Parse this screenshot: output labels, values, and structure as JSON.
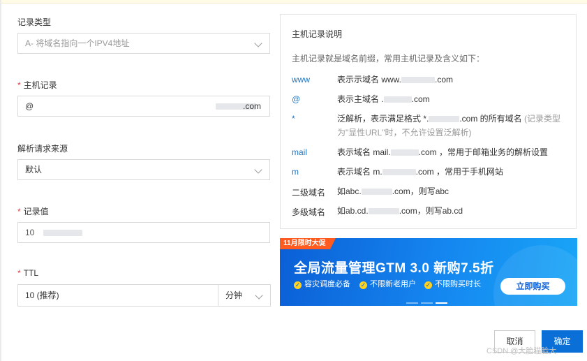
{
  "form": {
    "record_type": {
      "label": "记录类型",
      "value": "A- 将域名指向一个IPV4地址"
    },
    "host_record": {
      "label": "主机记录",
      "value": "@",
      "suffix": ".com"
    },
    "request_source": {
      "label": "解析请求来源",
      "value": "默认"
    },
    "record_value": {
      "label": "记录值",
      "value": "10"
    },
    "ttl": {
      "label": "TTL",
      "value": "10 (推荐)",
      "unit": "分钟"
    }
  },
  "help": {
    "title": "主机记录说明",
    "intro": "主机记录就是域名前缀，常用主机记录及含义如下：",
    "rows": [
      {
        "key": "www",
        "desc": "表示示域名 www.",
        "desc_tail": ".com"
      },
      {
        "key": "@",
        "desc": "表示主域名 .",
        "desc_tail": ".com"
      },
      {
        "key": "*",
        "desc": "泛解析，表示满足格式 *.",
        "desc_tail": ".com 的所有域名",
        "note": "(记录类型为\"显性URL\"时，不允许设置泛解析)"
      },
      {
        "key": "mail",
        "desc": "表示域名 mail.",
        "desc_tail": ".com ，常用于邮箱业务的解析设置"
      },
      {
        "key": "m",
        "desc": "表示域名 m.",
        "desc_tail": ".com ，常用于手机网站"
      },
      {
        "key": "二级域名",
        "desc": "如abc.",
        "desc_tail": ".com，则写abc"
      },
      {
        "key": "多级域名",
        "desc": "如ab.cd.",
        "desc_tail": ".com，则写ab.cd"
      }
    ]
  },
  "banner": {
    "tag": "11月限时大促",
    "title": "全局流量管理GTM 3.0 新购7.5折",
    "features": [
      "容灾调度必备",
      "不限新老用户",
      "不限购买时长"
    ],
    "cta": "立即购买",
    "colors": {
      "bg": "#1587f0",
      "tag": "#ff5a1f",
      "check": "#ffd21f"
    }
  },
  "footer": {
    "cancel": "取消",
    "ok": "确定",
    "watermark": "CSDN @大脸猫脸大"
  }
}
